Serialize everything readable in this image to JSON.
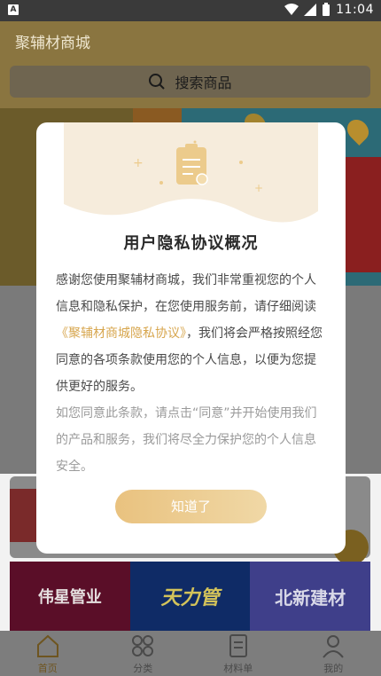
{
  "status_bar": {
    "time": "11:04"
  },
  "app_bar": {
    "title": "聚辅材商城"
  },
  "search": {
    "placeholder": "搜索商品"
  },
  "brands": [
    "伟星管业",
    "天力管",
    "北新建材"
  ],
  "bottom_nav": {
    "items": [
      {
        "label": "首页",
        "icon": "home-icon",
        "active": true
      },
      {
        "label": "分类",
        "icon": "grid-icon",
        "active": false
      },
      {
        "label": "材料单",
        "icon": "list-icon",
        "active": false
      },
      {
        "label": "我的",
        "icon": "user-icon",
        "active": false
      }
    ]
  },
  "privacy_dialog": {
    "title": "用户隐私协议概况",
    "para1_a": "感谢您使用聚辅材商城，我们非常重视您的个人信息和隐私保护，在您使用服务前，请仔细阅读",
    "para1_link": "《聚辅材商城隐私协议》",
    "para1_b": "，我们将会严格按照经您同意的各项条款使用您的个人信息，以便为您提供更好的服务。",
    "para2": "如您同意此条款，请点击“同意”并开始使用我们的产品和服务，我们将尽全力保护您的个人信息安全。",
    "confirm_label": "知道了"
  },
  "colors": {
    "accent_gold": "#e9c27f",
    "link": "#d7a64e"
  }
}
